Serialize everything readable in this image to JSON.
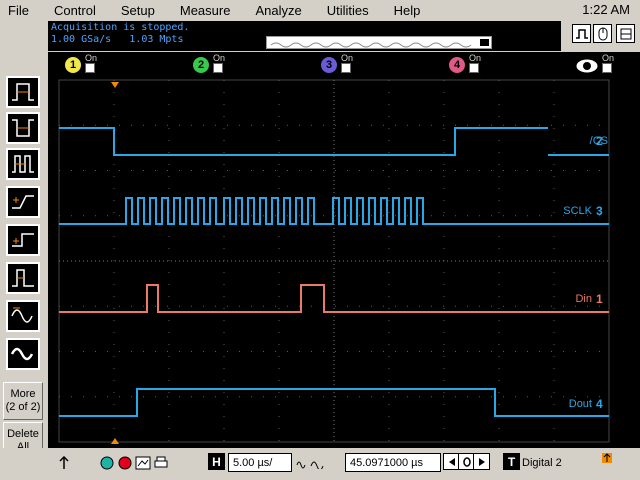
{
  "menu": {
    "items": [
      "File",
      "Control",
      "Setup",
      "Measure",
      "Analyze",
      "Utilities",
      "Help"
    ],
    "clock": "1:22 AM"
  },
  "status": {
    "message": "Acquisition is stopped.",
    "sample_rate": "1.00 GSa/s",
    "memory": "1.03 Mpts"
  },
  "channels": [
    {
      "number": "1",
      "on_label": "On",
      "color": "#f2e84b"
    },
    {
      "number": "2",
      "on_label": "On",
      "color": "#37c94c"
    },
    {
      "number": "3",
      "on_label": "On",
      "color": "#6b5bd6"
    },
    {
      "number": "4",
      "on_label": "On",
      "color": "#e05a86"
    }
  ],
  "display_on_label": "On",
  "signals": [
    {
      "name": "/CS",
      "channel": "2",
      "color": "#2aa7e6"
    },
    {
      "name": "SCLK",
      "channel": "3",
      "color": "#2aa7e6"
    },
    {
      "name": "Din",
      "channel": "1",
      "color": "#e87a68"
    },
    {
      "name": "Dout",
      "channel": "4",
      "color": "#2aa7e6"
    }
  ],
  "left_toolbar": {
    "more_label_line1": "More",
    "more_label_line2": "(2 of 2)",
    "delete_label_line1": "Delete",
    "delete_label_line2": "All"
  },
  "bottom": {
    "horizontal_label": "H",
    "time_per_div": "5.00 µs/",
    "delay": "45.0971000 µs",
    "trigger_label": "T",
    "trigger_source": "Digital 2"
  },
  "colors": {
    "trace_blue": "#2aa7e6",
    "trace_red": "#e87a68",
    "trigger_marker": "#f08a00",
    "grid": "#5a5a5a"
  }
}
